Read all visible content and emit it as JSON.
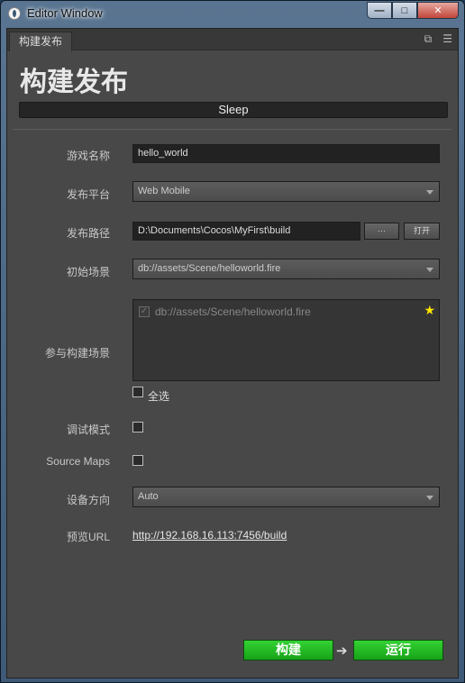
{
  "window": {
    "title": "Editor Window",
    "controls": {
      "minimize": "—",
      "maximize": "□",
      "close": "✕"
    }
  },
  "tab": {
    "label": "构建发布"
  },
  "heading": "构建发布",
  "status": "Sleep",
  "form": {
    "game_name": {
      "label": "游戏名称",
      "value": "hello_world"
    },
    "platform": {
      "label": "发布平台",
      "value": "Web Mobile"
    },
    "build_path": {
      "label": "发布路径",
      "value": "D:\\Documents\\Cocos\\MyFirst\\build",
      "browse_label": "···",
      "open_label": "打开"
    },
    "start_scene": {
      "label": "初始场景",
      "value": "db://assets/Scene/helloworld.fire"
    },
    "included_scenes": {
      "label": "参与构建场景",
      "items": [
        "db://assets/Scene/helloworld.fire"
      ],
      "select_all_label": "全选"
    },
    "debug_mode": {
      "label": "调试模式",
      "checked": false
    },
    "source_maps": {
      "label": "Source Maps",
      "checked": false
    },
    "orientation": {
      "label": "设备方向",
      "value": "Auto"
    },
    "preview_url": {
      "label": "预览URL",
      "value": "http://192.168.16.113:7456/build"
    }
  },
  "actions": {
    "build_label": "构建",
    "run_label": "运行"
  },
  "colors": {
    "accent_green": "#22b822",
    "star": "#ffe600",
    "panel_bg": "#484848"
  }
}
